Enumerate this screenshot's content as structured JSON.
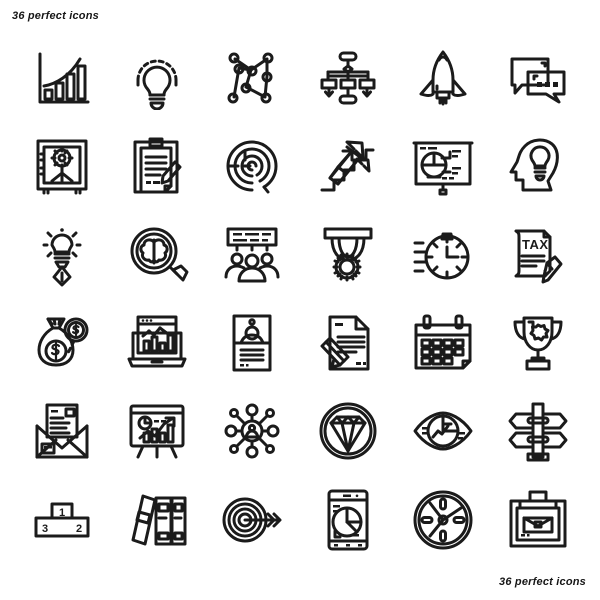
{
  "page": {
    "title_top": "36 perfect icons",
    "title_bottom": "36 perfect icons",
    "background_color": "#ffffff",
    "stroke_color": "#1b1b1b",
    "columns": 6,
    "rows": 6,
    "icon_count": 36
  },
  "icons": [
    {
      "index": 1,
      "name": "growth-bar-chart-icon",
      "label": "Growth Bar Chart"
    },
    {
      "index": 2,
      "name": "lightbulb-rays-icon",
      "label": "Idea Lightbulb"
    },
    {
      "index": 3,
      "name": "node-network-icon",
      "label": "Connected Nodes"
    },
    {
      "index": 4,
      "name": "flowchart-hierarchy-icon",
      "label": "Flowchart Hierarchy"
    },
    {
      "index": 5,
      "name": "rocket-launch-icon",
      "label": "Rocket Launch"
    },
    {
      "index": 6,
      "name": "chat-bubbles-icon",
      "label": "Chat Bubbles"
    },
    {
      "index": 7,
      "name": "safe-vault-icon",
      "label": "Safe Vault"
    },
    {
      "index": 8,
      "name": "clipboard-contract-icon",
      "label": "Clipboard Contract"
    },
    {
      "index": 9,
      "name": "spiral-maze-icon",
      "label": "Spiral Maze"
    },
    {
      "index": 10,
      "name": "stairs-arrows-icon",
      "label": "Stairs With Arrows"
    },
    {
      "index": 11,
      "name": "presentation-pie-icon",
      "label": "Pie Chart Presentation"
    },
    {
      "index": 12,
      "name": "head-lightbulb-icon",
      "label": "Head With Lightbulb"
    },
    {
      "index": 13,
      "name": "lightbulb-pen-nib-icon",
      "label": "Creative Pen Bulb"
    },
    {
      "index": 14,
      "name": "brain-magnifier-icon",
      "label": "Brain Research"
    },
    {
      "index": 15,
      "name": "team-board-icon",
      "label": "Team Briefing"
    },
    {
      "index": 16,
      "name": "medal-ribbon-icon",
      "label": "Award Medal"
    },
    {
      "index": 17,
      "name": "stopwatch-speed-icon",
      "label": "Fast Stopwatch"
    },
    {
      "index": 18,
      "name": "tax-document-pencil-icon",
      "label": "Tax Document"
    },
    {
      "index": 19,
      "name": "money-bag-coin-icon",
      "label": "Money Bag"
    },
    {
      "index": 20,
      "name": "laptop-analytics-icon",
      "label": "Laptop Analytics"
    },
    {
      "index": 21,
      "name": "id-card-profile-icon",
      "label": "Profile ID Card"
    },
    {
      "index": 22,
      "name": "document-pencil-icon",
      "label": "Document Editing"
    },
    {
      "index": 23,
      "name": "calendar-icon",
      "label": "Calendar"
    },
    {
      "index": 24,
      "name": "trophy-badge-icon",
      "label": "Trophy"
    },
    {
      "index": 25,
      "name": "envelope-letter-icon",
      "label": "Open Mail"
    },
    {
      "index": 26,
      "name": "presentation-growth-icon",
      "label": "Growth Presentation"
    },
    {
      "index": 27,
      "name": "network-hub-person-icon",
      "label": "Social Network Hub"
    },
    {
      "index": 28,
      "name": "diamond-circle-icon",
      "label": "Diamond Value"
    },
    {
      "index": 29,
      "name": "eye-chart-vision-icon",
      "label": "Vision Insight"
    },
    {
      "index": 30,
      "name": "signpost-direction-icon",
      "label": "Signpost Direction"
    },
    {
      "index": 31,
      "name": "winner-podium-icon",
      "label": "Winner Podium"
    },
    {
      "index": 32,
      "name": "archive-binders-icon",
      "label": "Archive Binders"
    },
    {
      "index": 33,
      "name": "target-arrow-icon",
      "label": "Target With Arrow"
    },
    {
      "index": 34,
      "name": "smartphone-pie-chart-icon",
      "label": "Mobile Analytics"
    },
    {
      "index": 35,
      "name": "compass-wheel-icon",
      "label": "Compass Wheel"
    },
    {
      "index": 36,
      "name": "briefcase-case-icon",
      "label": "Business Briefcase"
    }
  ],
  "icon_text": {
    "tax_label": "TAX",
    "podium_first": "1",
    "podium_second": "2",
    "podium_third": "3"
  }
}
